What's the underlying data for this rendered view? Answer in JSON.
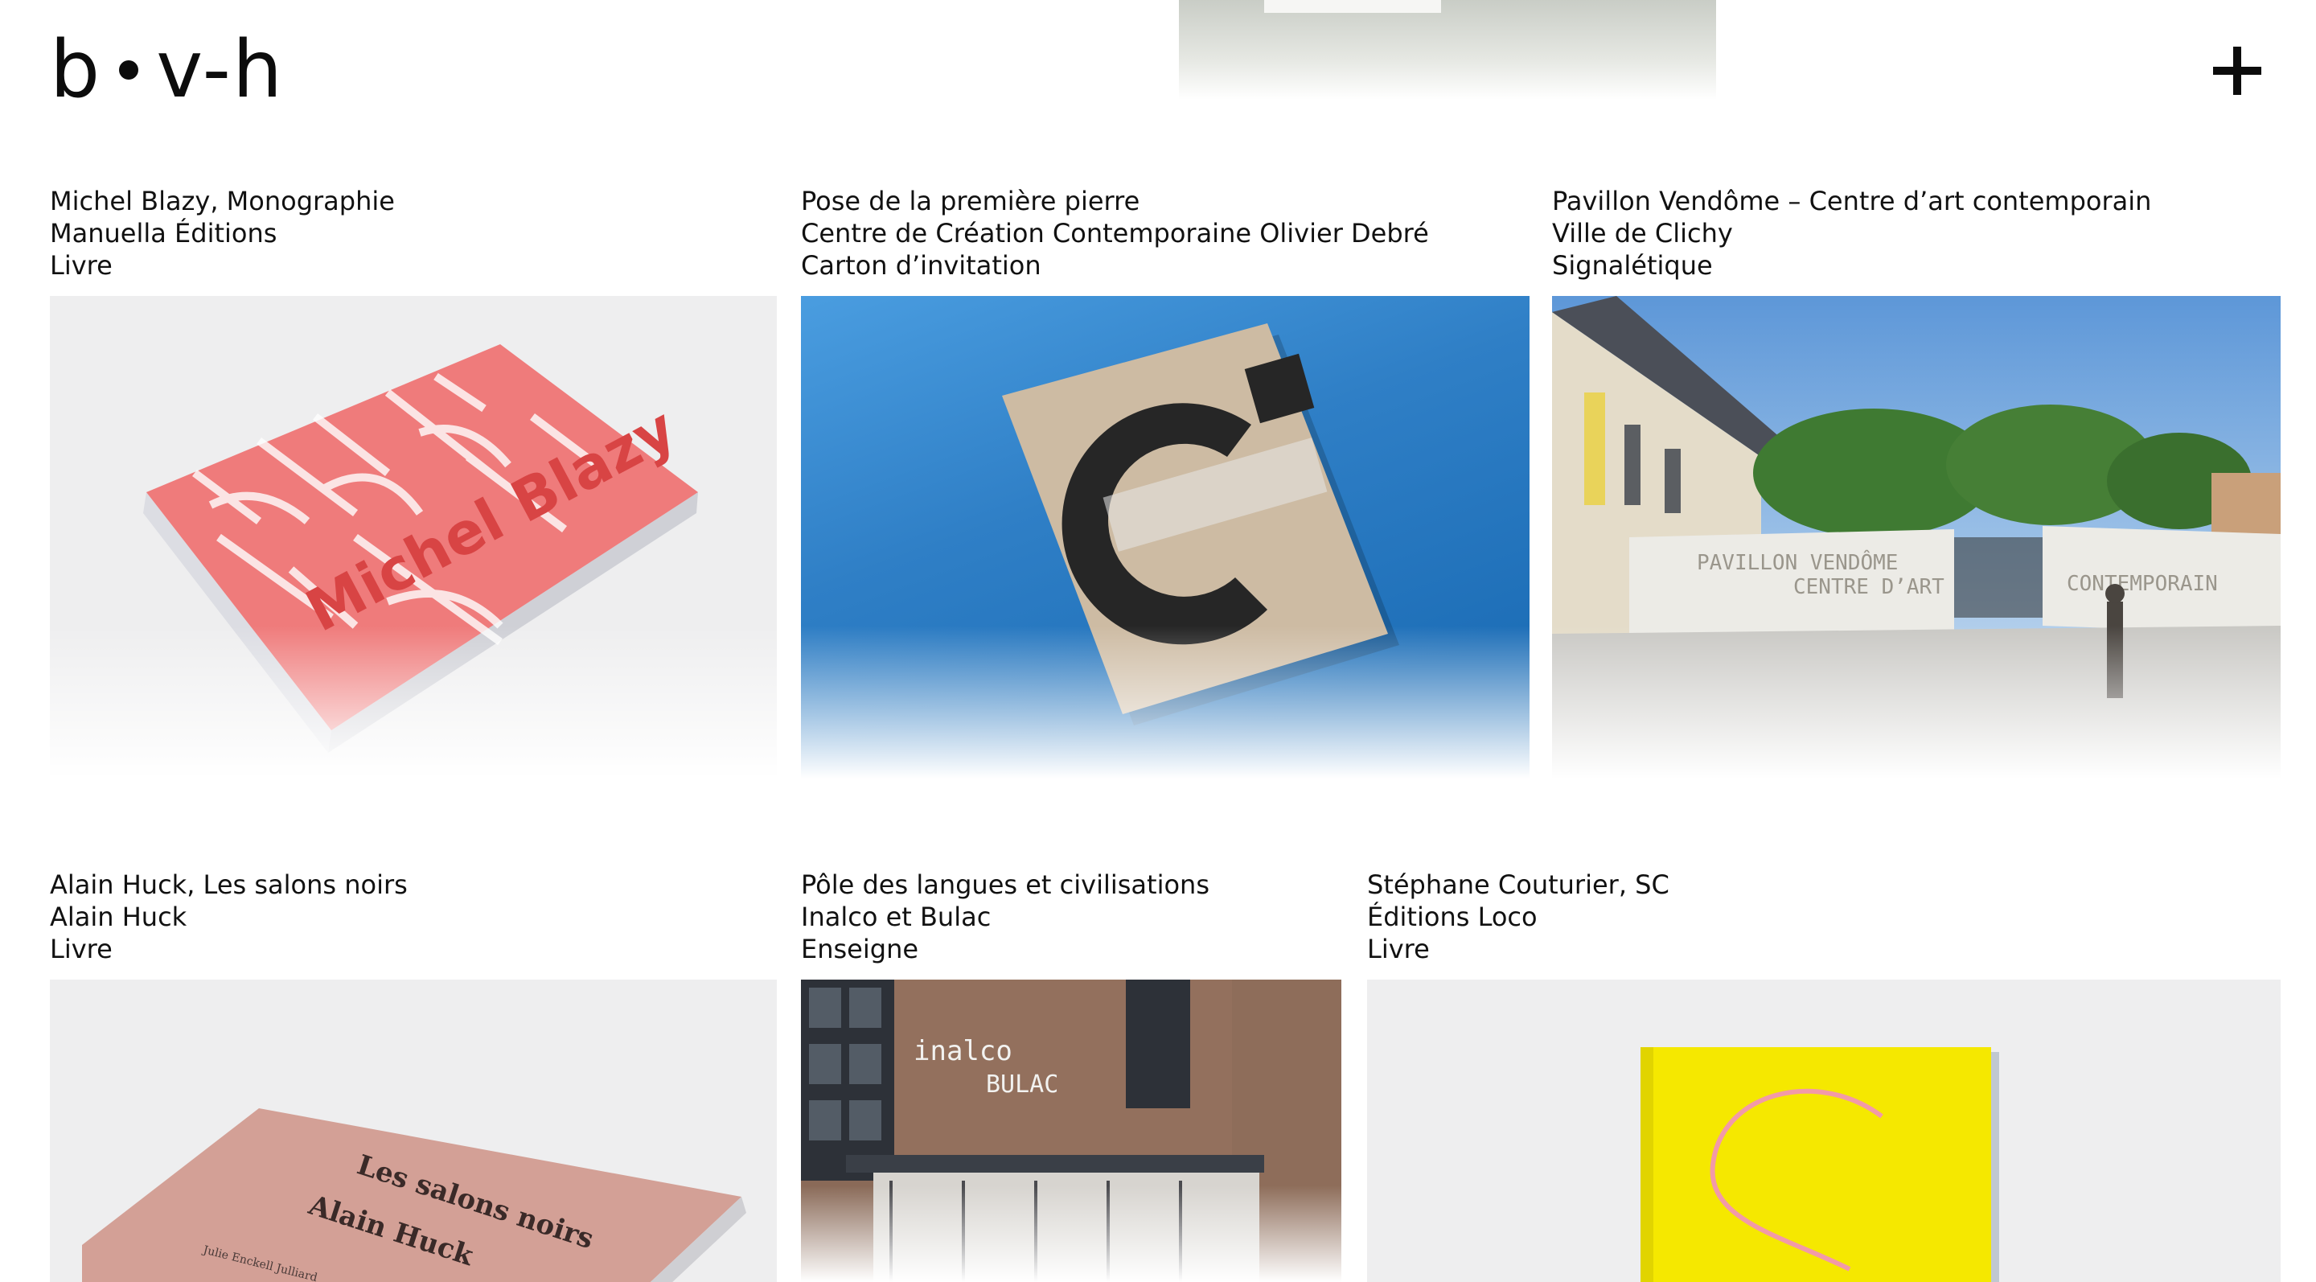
{
  "header": {
    "logo": {
      "left": "b",
      "right": "v-h"
    },
    "menu_icon": "plus-icon"
  },
  "projects": [
    {
      "title": "Michel Blazy, Monographie",
      "client": "Manuella Éditions",
      "category": "Livre",
      "image_text": "Michel Blazy"
    },
    {
      "title": "Pose de la première pierre",
      "client": "Centre de Création Contemporaine Olivier Debré",
      "category": "Carton d’invitation"
    },
    {
      "title": "Pavillon Vendôme – Centre d’art contemporain",
      "client": "Ville de Clichy",
      "category": "Signalétique",
      "image_text": {
        "line1": "PAVILLON VENDÔME",
        "line2": "CENTRE D’ART",
        "line3": "CONTEMPORAIN"
      }
    },
    {
      "title": "Alain Huck, Les salons noirs",
      "client": "Alain Huck",
      "category": "Livre",
      "image_text": {
        "author": "Alain Huck",
        "title": "Les salons noirs",
        "spine": "Julie Enckell Julliard"
      }
    },
    {
      "title": "Pôle des langues et civilisations",
      "client": "Inalco et Bulac",
      "category": "Enseigne",
      "image_text": {
        "line1": "inalco",
        "line2": "BULAC"
      }
    },
    {
      "title": "Stéphane Couturier, SC",
      "client": "Éditions Loco",
      "category": "Livre"
    }
  ],
  "colors": {
    "text": "#111111",
    "background": "#ffffff",
    "card_blue": "#2f7fc6",
    "book_red": "#ee5353",
    "book_yellow": "#f5e800"
  }
}
